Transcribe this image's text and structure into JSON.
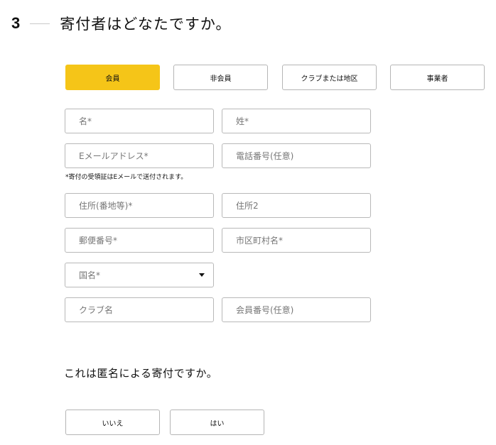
{
  "header": {
    "step_number": "3",
    "title": "寄付者はどなたですか。"
  },
  "donor_types": {
    "selected": "会員",
    "options": [
      "会員",
      "非会員",
      "クラブまたは地区",
      "事業者"
    ]
  },
  "fields": {
    "first_name": "名*",
    "last_name": "姓*",
    "email": "Eメールアドレス*",
    "phone": "電話番号(任意)",
    "email_note": "*寄付の受領証はEメールで送付されます。",
    "address1": "住所(番地等)*",
    "address2": "住所2",
    "postal_code": "郵便番号*",
    "city": "市区町村名*",
    "country": "国名*",
    "club_name": "クラブ名",
    "member_number": "会員番号(任意)"
  },
  "anonymous": {
    "question": "これは匿名による寄付ですか。",
    "options": [
      "いいえ",
      "はい"
    ]
  }
}
